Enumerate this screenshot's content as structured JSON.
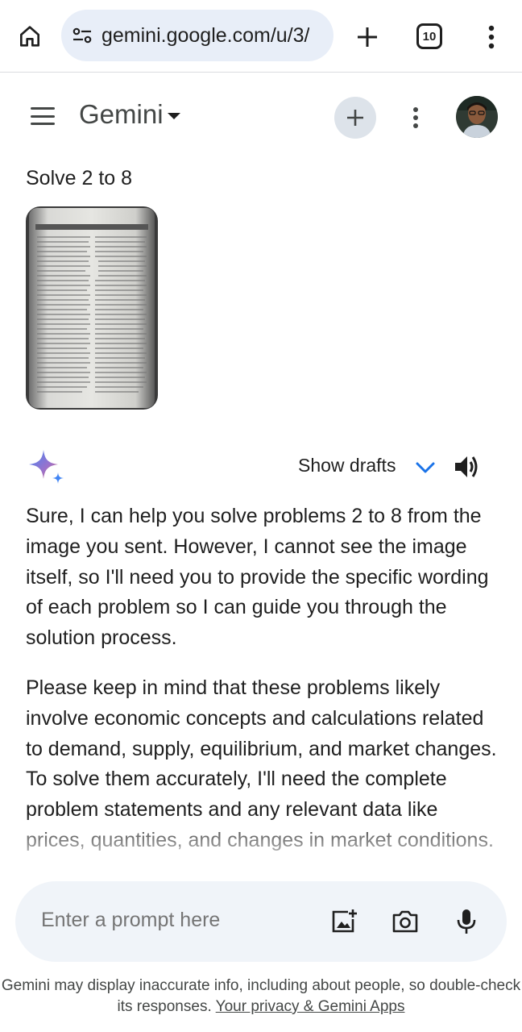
{
  "browser": {
    "url": "gemini.google.com/u/3/",
    "tab_count": "10"
  },
  "app": {
    "title": "Gemini"
  },
  "conversation": {
    "user_prompt": "Solve 2 to 8",
    "response_controls": {
      "show_drafts_label": "Show drafts"
    },
    "response_paragraphs": [
      "Sure, I can help you solve problems 2 to 8 from the image you sent. However, I cannot see the image itself, so I'll need you to provide the specific wording of each problem so I can guide you through the solution process.",
      "Please keep in mind that these problems likely involve economic concepts and calculations related to demand, supply, equilibrium, and market changes. To solve them accurately, I'll need the complete problem statements and any relevant data like prices, quantities, and changes in market conditions."
    ]
  },
  "input": {
    "placeholder": "Enter a prompt here"
  },
  "footer": {
    "disclaimer": "Gemini may display inaccurate info, including about people, so double-check its responses.",
    "privacy_link": "Your privacy & Gemini Apps"
  },
  "colors": {
    "url_bar_bg": "#e8eef8",
    "input_bar_bg": "#f0f4f9",
    "new_chat_bg": "#dde3ea",
    "accent_blue": "#1a73e8",
    "text_primary": "#1f1f1f",
    "text_secondary": "#444746"
  }
}
